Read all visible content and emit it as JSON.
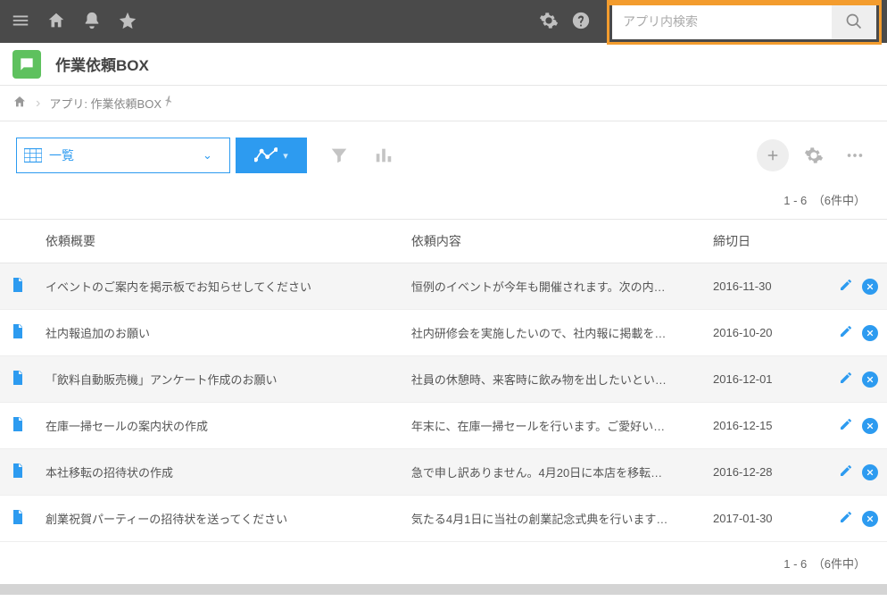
{
  "search": {
    "placeholder": "アプリ内検索"
  },
  "app": {
    "title": "作業依頼BOX"
  },
  "breadcrumb": {
    "label": "アプリ: 作業依頼BOX"
  },
  "view": {
    "label": "一覧"
  },
  "pagination": {
    "text": "1 - 6　（6件中）"
  },
  "columns": {
    "summary": "依頼概要",
    "content": "依頼内容",
    "deadline": "締切日"
  },
  "rows": [
    {
      "summary": "イベントのご案内を掲示板でお知らせしてください",
      "content": "恒例のイベントが今年も開催されます。次の内…",
      "deadline": "2016-11-30"
    },
    {
      "summary": "社内報追加のお願い",
      "content": "社内研修会を実施したいので、社内報に掲載を…",
      "deadline": "2016-10-20"
    },
    {
      "summary": "「飲料自動販売機」アンケート作成のお願い",
      "content": "社員の休憩時、来客時に飲み物を出したいとい…",
      "deadline": "2016-12-01"
    },
    {
      "summary": "在庫一掃セールの案内状の作成",
      "content": "年末に、在庫一掃セールを行います。ご愛好い…",
      "deadline": "2016-12-15"
    },
    {
      "summary": "本社移転の招待状の作成",
      "content": "急で申し訳ありません。4月20日に本店を移転…",
      "deadline": "2016-12-28"
    },
    {
      "summary": "創業祝賀パーティーの招待状を送ってください",
      "content": "気たる4月1日に当社の創業記念式典を行います…",
      "deadline": "2017-01-30"
    }
  ]
}
